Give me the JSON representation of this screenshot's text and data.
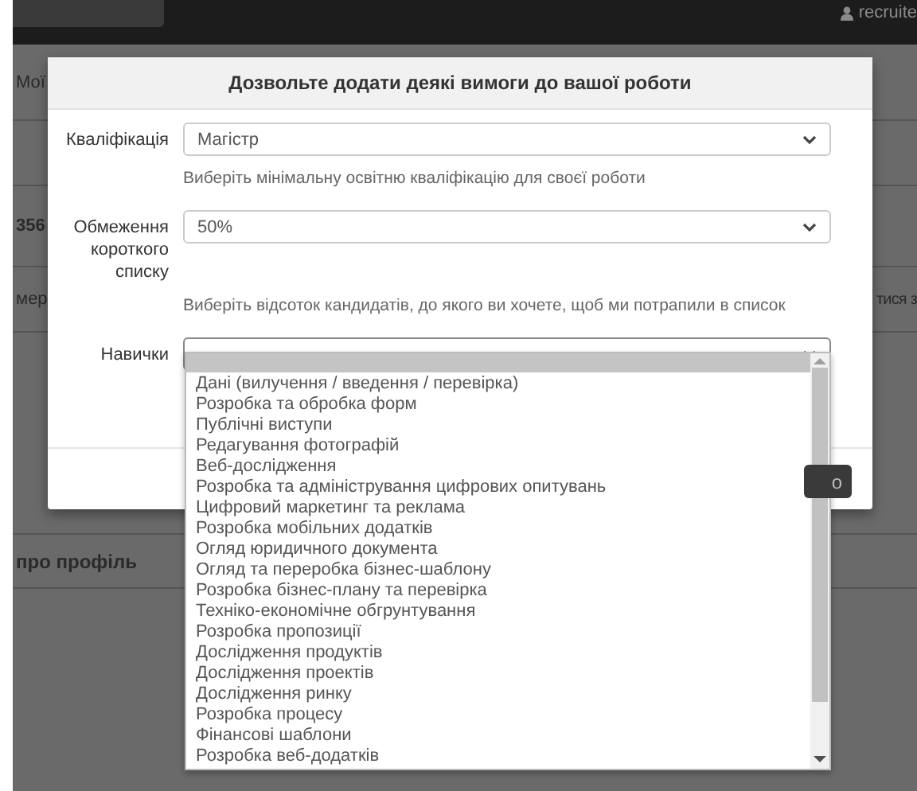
{
  "navbar": {
    "user": "recruite"
  },
  "background": {
    "tab_text": "Мої",
    "row_text_1": "356",
    "row_text_2": "мер",
    "row_text_3": "тися з",
    "section_title": "про профіль",
    "button_text": "о"
  },
  "modal": {
    "title": "Дозвольте додати деякі вимоги до вашої роботи",
    "fields": [
      {
        "label": "Кваліфікація",
        "value": "Магістр",
        "hint": "Виберіть мінімальну освітню кваліфікацію для своєї роботи"
      },
      {
        "label": "Обмеження короткого списку",
        "value": "50%",
        "hint": "Виберіть відсоток кандидатів, до якого ви хочете, щоб ми потрапили в список"
      },
      {
        "label": "Навички"
      }
    ]
  },
  "dropdown": {
    "blank_selected": true,
    "options": [
      "Дані (вилучення / введення / перевірка)",
      "Розробка та обробка форм",
      "Публічні виступи",
      "Редагування фотографій",
      "Веб-дослідження",
      "Розробка та адміністрування цифрових опитувань",
      "Цифровий маркетинг та реклама",
      "Розробка мобільних додатків",
      "Огляд юридичного документа",
      "Огляд та переробка бізнес-шаблону",
      "Розробка бізнес-плану та перевірка",
      "Техніко-економічне обгрунтування",
      "Розробка пропозиції",
      "Дослідження продуктів",
      "Дослідження проектів",
      "Дослідження ринку",
      "Розробка процесу",
      "Фінансові шаблони",
      "Розробка веб-додатків"
    ]
  }
}
